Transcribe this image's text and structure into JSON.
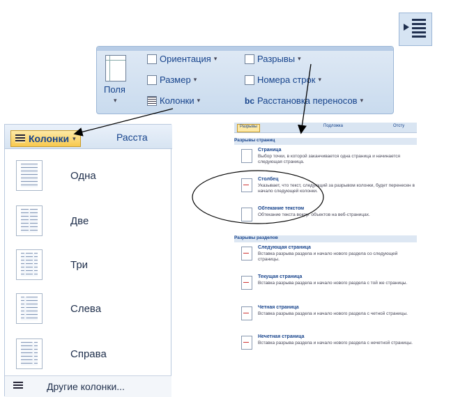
{
  "ribbon": {
    "fields_label": "Поля",
    "orientation_label": "Ориентация",
    "size_label": "Размер",
    "columns_label": "Колонки",
    "breaks_label": "Разрывы",
    "line_numbers_label": "Номера строк",
    "hyphenation_label": "Расстановка переносов",
    "hyphen_glyph": "bc"
  },
  "left_menu": {
    "columns_button": "Колонки",
    "hyphenation_partial": "Расста",
    "items": [
      {
        "label": "Одна",
        "cols": 1
      },
      {
        "label": "Две",
        "cols": 2
      },
      {
        "label": "Три",
        "cols": 3
      },
      {
        "label": "Слева",
        "cols": "left"
      },
      {
        "label": "Справа",
        "cols": "right"
      }
    ],
    "more_columns": "Другие колонки..."
  },
  "right_menu": {
    "tabs": [
      "Разрывы",
      "Подложка",
      "Отсту"
    ],
    "page_breaks_header": "Разрывы страниц",
    "page_breaks": [
      {
        "title": "Страница",
        "desc": "Выбор точки, в которой заканчивается одна страница и начинается следующая страница."
      },
      {
        "title": "Столбец",
        "desc": "Указывает, что текст, следующий за разрывом колонки, будет перенесен в начало следующей колонки."
      },
      {
        "title": "Обтекание текстом",
        "desc": "Обтекание текста вокруг объектов на веб-страницах."
      }
    ],
    "section_breaks_header": "Разрывы разделов",
    "section_breaks": [
      {
        "title": "Следующая страница",
        "desc": "Вставка разрыва раздела и начало нового раздела со следующей страницы."
      },
      {
        "title": "Текущая страница",
        "desc": "Вставка разрыва раздела и начало нового раздела с той же страницы."
      },
      {
        "title": "Четная страница",
        "desc": "Вставка разрыва раздела и начало нового раздела с четной страницы."
      },
      {
        "title": "Нечетная страница",
        "desc": "Вставка разрыва раздела и начало нового раздела с нечетной страницы."
      }
    ]
  },
  "icons": {
    "top_right": "increase-indent-icon",
    "arrow_color": "#000000",
    "highlight_color": "#f8c94e"
  }
}
